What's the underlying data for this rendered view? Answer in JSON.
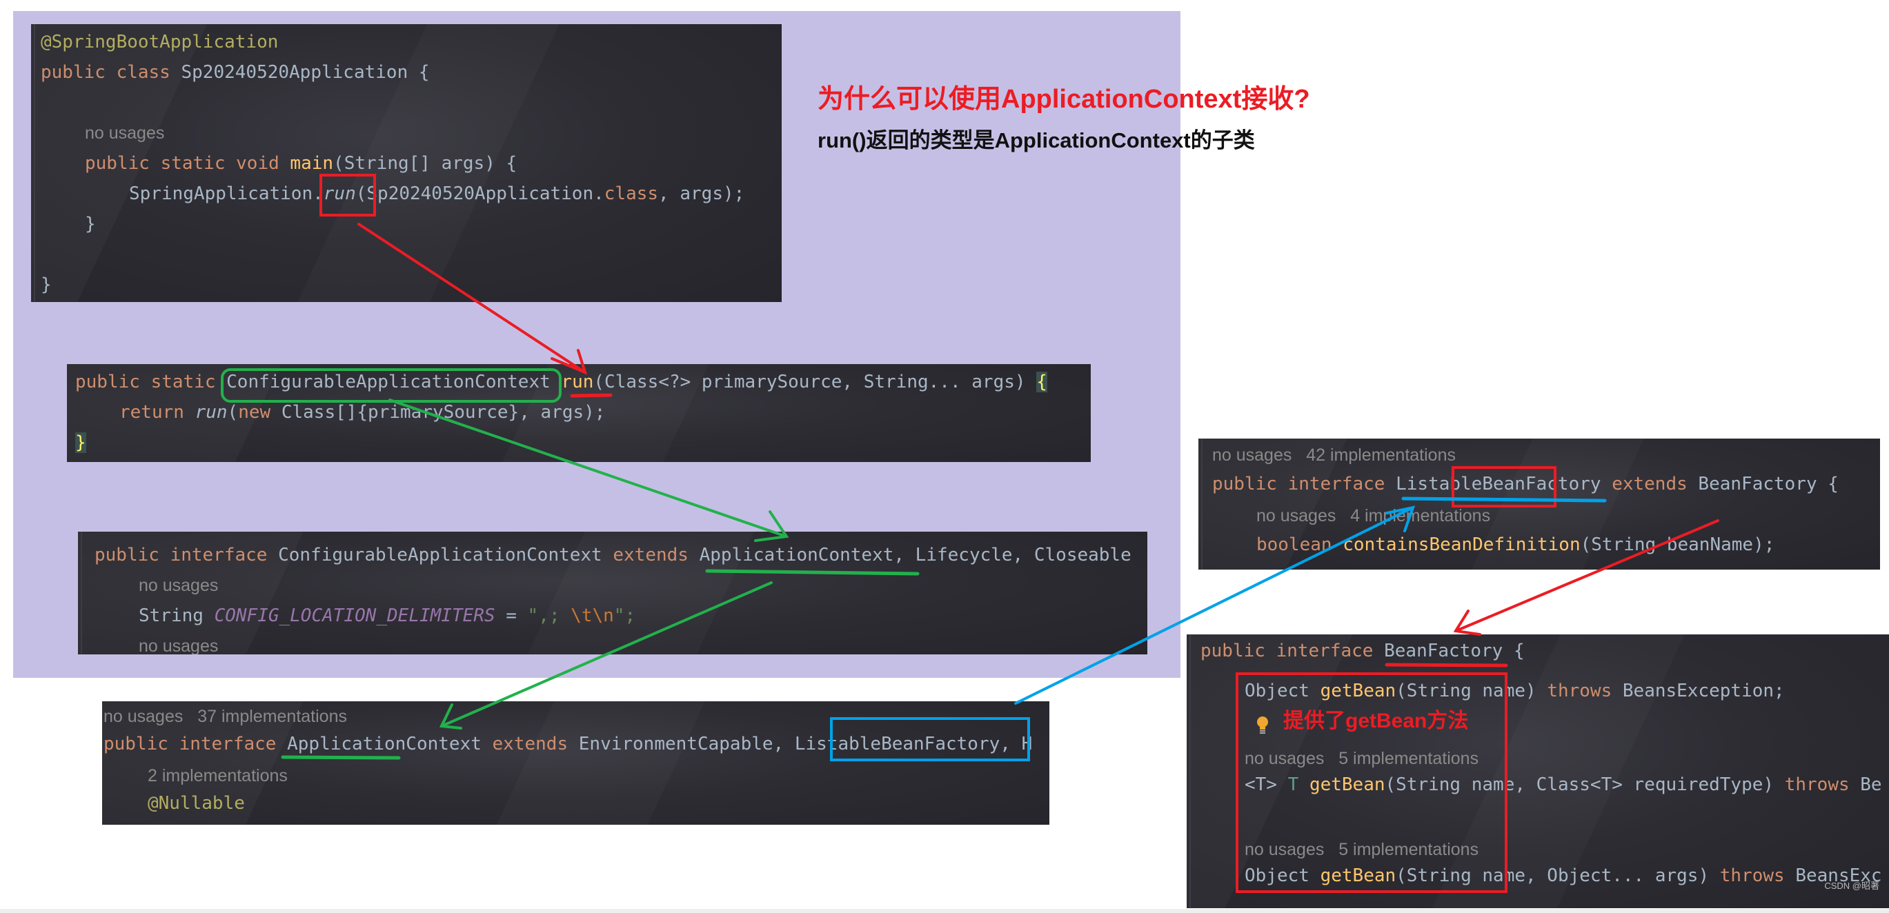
{
  "annotations": {
    "question": "为什么可以使用ApplicationContext接收?",
    "answer": "run()返回的类型是ApplicationContext的子类",
    "getbean_note": "提供了getBean方法",
    "watermark": "CSDN @昭著"
  },
  "colors": {
    "highlight_background": "#c6bfe5",
    "editor_background": "#2b2a31",
    "keyword": "#cf8e6d",
    "annotation": "#b3ae60",
    "method": "#ffc66d",
    "plain": "#a9b7c6",
    "hint": "#8a8a8a",
    "markup_red": "#ec1c24",
    "markup_green": "#22b14c",
    "markup_blue": "#00a2e8"
  },
  "snippet_main": {
    "annotation": "@SpringBootApplication",
    "class_kw": "public class",
    "class_name": "Sp20240520Application {",
    "usage_hint": "no usages",
    "main_kw": "public static void",
    "main_name": "main",
    "main_params": "(String[] args) {",
    "call_prefix": "SpringApplication.",
    "call_method": "run",
    "call_args_a": "(Sp20240520Application.",
    "call_class_kw": "class",
    "call_args_b": ", args);",
    "close_inner": "}",
    "close_outer": "}"
  },
  "snippet_run": {
    "modifiers": "public static",
    "return_type": "ConfigurableApplicationContext",
    "method": "run",
    "params": "(Class<?> primarySource, String... args)",
    "open_brace": "{",
    "return_kw": "return",
    "inner_call": "run",
    "new_kw": "new",
    "inner_args": "Class[]{primarySource}, args);",
    "close_brace": "}"
  },
  "snippet_configurable": {
    "decl_kw": "public interface",
    "name": "ConfigurableApplicationContext",
    "extends_kw": "extends",
    "parents": "ApplicationContext, Lifecycle, Closeable",
    "usage_hint_1": "no usages",
    "field_type": "String",
    "field_name": "CONFIG_LOCATION_DELIMITERS",
    "field_eq": " = ",
    "field_value_a": "\",; ",
    "field_value_esc": "\\t\\n",
    "field_value_b": "\";",
    "usage_hint_2": "no usages"
  },
  "snippet_application_context": {
    "usage_hint": "no usages   37 implementations",
    "decl_kw": "public interface",
    "name": "ApplicationContext",
    "extends_kw": "extends",
    "parent_1": "EnvironmentCapable,",
    "parent_2": "ListableBeanFactory,",
    "parent_3": "H",
    "impl_hint": "2 implementations",
    "annotation": "@Nullable"
  },
  "snippet_listable": {
    "usage_hint": "no usages   42 implementations",
    "decl_kw": "public interface",
    "name": "ListableBeanFactory",
    "extends_kw": "extends",
    "parent": "BeanFactory",
    "open_brace": "{",
    "usage_hint_2": "no usages   4 implementations",
    "method_type": "boolean",
    "method_name": "containsBeanDefinition",
    "method_params": "(String beanName);"
  },
  "snippet_beanfactory": {
    "decl_kw": "public interface",
    "name": "BeanFactory",
    "open_brace": "{",
    "m1_type": "Object",
    "m1_name": "getBean",
    "m1_params": "(String name)",
    "m1_throws": "throws",
    "m1_exc": "BeansException;",
    "usage_hint_1": "no usages   5 implementations",
    "m2_generic": "<T>",
    "m2_type": "T",
    "m2_name": "getBean",
    "m2_params": "(String name, Class<T> requiredType)",
    "m2_throws": "throws",
    "m2_exc": "Be",
    "usage_hint_2": "no usages   5 implementations",
    "m3_type": "Object",
    "m3_name": "getBean",
    "m3_params": "(String name, Object... args)",
    "m3_throws": "throws",
    "m3_exc": "BeansExc"
  }
}
